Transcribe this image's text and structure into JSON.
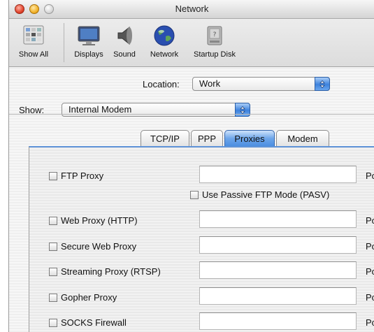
{
  "window": {
    "title": "Network"
  },
  "toolbar": {
    "items": [
      {
        "label": "Show All",
        "icon": "show-all-icon"
      },
      {
        "label": "Displays",
        "icon": "displays-icon"
      },
      {
        "label": "Sound",
        "icon": "sound-icon"
      },
      {
        "label": "Network",
        "icon": "network-icon"
      },
      {
        "label": "Startup Disk",
        "icon": "startup-disk-icon"
      }
    ]
  },
  "location": {
    "label": "Location:",
    "value": "Work"
  },
  "show": {
    "label": "Show:",
    "value": "Internal Modem"
  },
  "tabs": [
    {
      "label": "TCP/IP",
      "active": false
    },
    {
      "label": "PPP",
      "active": false
    },
    {
      "label": "Proxies",
      "active": true
    },
    {
      "label": "Modem",
      "active": false
    }
  ],
  "proxies": {
    "port_label": "Port:",
    "passive_ftp": {
      "label": "Use Passive FTP Mode (PASV)",
      "checked": false
    },
    "rows": [
      {
        "label": "FTP Proxy",
        "checked": false,
        "server": ""
      },
      {
        "label": "Web Proxy (HTTP)",
        "checked": false,
        "server": ""
      },
      {
        "label": "Secure Web Proxy",
        "checked": false,
        "server": ""
      },
      {
        "label": "Streaming Proxy (RTSP)",
        "checked": false,
        "server": ""
      },
      {
        "label": "Gopher Proxy",
        "checked": false,
        "server": ""
      },
      {
        "label": "SOCKS Firewall",
        "checked": false,
        "server": ""
      }
    ]
  },
  "colors": {
    "accent": "#4c8fe1",
    "close": "#e2442c",
    "minimize": "#f1b22a"
  }
}
